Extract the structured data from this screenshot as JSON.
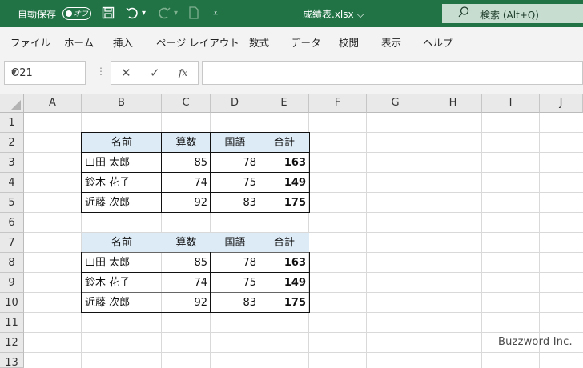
{
  "titlebar": {
    "autosave_label": "自動保存",
    "toggle_label": "オフ",
    "filename": "成績表.xlsx",
    "search_placeholder": "検索 (Alt+Q)",
    "bg_color": "#217346"
  },
  "ribbon": {
    "tabs": [
      "ファイル",
      "ホーム",
      "挿入",
      "ページ レイアウト",
      "数式",
      "データ",
      "校閲",
      "表示",
      "ヘルプ"
    ]
  },
  "formula_bar": {
    "name_box": "O21",
    "cancel": "✕",
    "enter": "✓",
    "fx": "fx",
    "content": ""
  },
  "sheet": {
    "columns": [
      "A",
      "B",
      "C",
      "D",
      "E",
      "F",
      "G",
      "H",
      "I",
      "J"
    ],
    "rows": [
      "1",
      "2",
      "3",
      "4",
      "5",
      "6",
      "7",
      "8",
      "9",
      "10",
      "11",
      "12",
      "13"
    ],
    "header_fill": "#ddebf7",
    "table1": {
      "headers": [
        "名前",
        "算数",
        "国語",
        "合計"
      ],
      "rows": [
        [
          "山田 太郎",
          "85",
          "78",
          "163"
        ],
        [
          "鈴木 花子",
          "74",
          "75",
          "149"
        ],
        [
          "近藤 次郎",
          "92",
          "83",
          "175"
        ]
      ]
    },
    "table2": {
      "headers": [
        "名前",
        "算数",
        "国語",
        "合計"
      ],
      "rows": [
        [
          "山田 太郎",
          "85",
          "78",
          "163"
        ],
        [
          "鈴木 花子",
          "74",
          "75",
          "149"
        ],
        [
          "近藤 次郎",
          "92",
          "83",
          "175"
        ]
      ]
    }
  },
  "watermark": "Buzzword Inc."
}
